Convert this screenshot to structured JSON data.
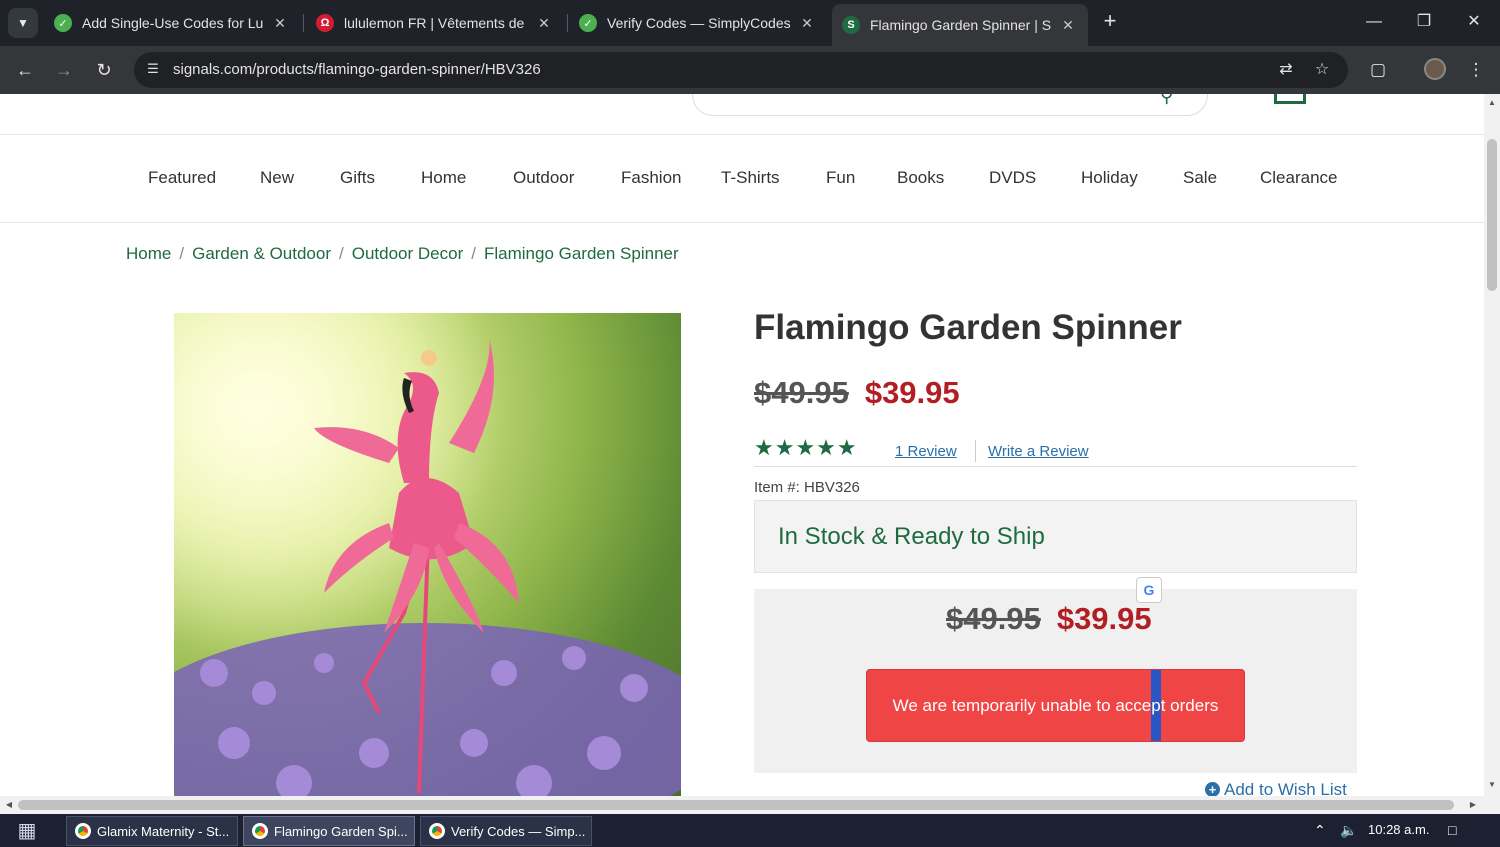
{
  "browser": {
    "tabs": [
      {
        "title": "Add Single-Use Codes for Lulul",
        "favicon_color": "#4caf50"
      },
      {
        "title": "lululemon FR | Vêtements de Yo",
        "favicon_color": "#d31c34"
      },
      {
        "title": "Verify Codes — SimplyCodes",
        "favicon_color": "#4caf50"
      },
      {
        "title": "Flamingo Garden Spinner | Sign",
        "favicon_color": "#1e6b42"
      }
    ],
    "url": "signals.com/products/flamingo-garden-spinner/HBV326"
  },
  "nav": {
    "items": [
      "Featured",
      "New",
      "Gifts",
      "Home",
      "Outdoor",
      "Fashion",
      "T-Shirts",
      "Fun",
      "Books",
      "DVDS",
      "Holiday",
      "Sale",
      "Clearance"
    ]
  },
  "breadcrumb": [
    "Home",
    "Garden & Outdoor",
    "Outdoor Decor",
    "Flamingo Garden Spinner"
  ],
  "product": {
    "title": "Flamingo Garden Spinner",
    "old_price": "$49.95",
    "new_price": "$39.95",
    "stars": "★★★★★",
    "rating_stars": 5,
    "review_link": "1 Review",
    "write_review": "Write a Review",
    "item_number": "Item #: HBV326",
    "stock_status": "In Stock & Ready to Ship",
    "order_message_before": "We are temporarily unable to acce",
    "order_message_cursor": "p",
    "order_message_after": "t orders",
    "wishlist": "Add to Wish List"
  },
  "taskbar": {
    "items": [
      "Glamix Maternity - St...",
      "Flamingo Garden Spi...",
      "Verify Codes — Simp..."
    ],
    "time": "10:28 a.m."
  },
  "colors": {
    "brand_green": "#1e6b42",
    "sale_red": "#b11e23",
    "alert_button": "#f04545",
    "link_blue": "#2a6fa8"
  }
}
